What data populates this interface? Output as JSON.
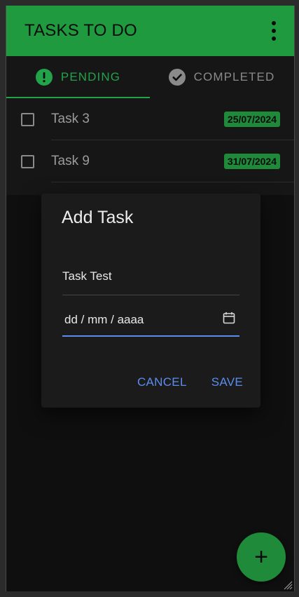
{
  "appbar": {
    "title": "TASKS TO DO",
    "menu_icon": "more-vert-icon"
  },
  "tabs": [
    {
      "label": "PENDING",
      "icon": "alert-circle-icon",
      "active": true
    },
    {
      "label": "COMPLETED",
      "icon": "check-circle-icon",
      "active": false
    }
  ],
  "tasks": [
    {
      "name": "Task 3",
      "date": "25/07/2024",
      "checked": false
    },
    {
      "name": "Task 9",
      "date": "31/07/2024",
      "checked": false
    }
  ],
  "dialog": {
    "title": "Add Task",
    "task_value": "Task Test",
    "date_placeholder": "dd / mm / aaaa",
    "cancel_label": "CANCEL",
    "save_label": "SAVE"
  },
  "fab": {
    "label": "+",
    "icon": "plus-icon"
  },
  "colors": {
    "accent": "#22a34a",
    "badge": "#1e8a3a",
    "link": "#5b8def"
  }
}
